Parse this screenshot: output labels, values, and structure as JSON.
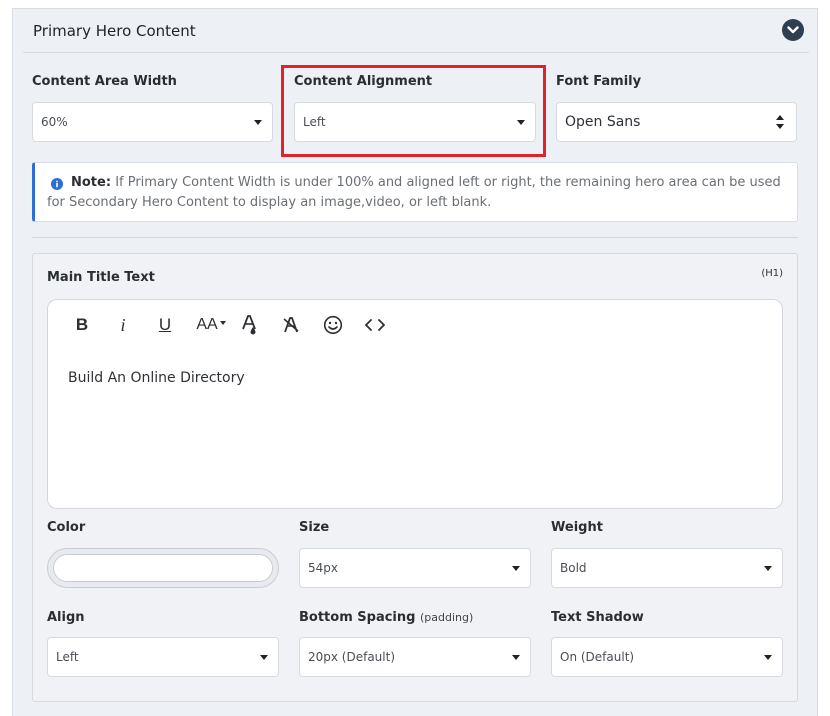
{
  "panel": {
    "title": "Primary Hero Content"
  },
  "fields": {
    "content_area_width": {
      "label": "Content Area Width",
      "value": "60%"
    },
    "content_alignment": {
      "label": "Content Alignment",
      "value": "Left"
    },
    "font_family": {
      "label": "Font Family",
      "value": "Open Sans"
    }
  },
  "note": {
    "label": "Note:",
    "text": "If Primary Content Width is under 100% and aligned left or right, the remaining hero area can be used for Secondary Hero Content to display an image,video, or left blank."
  },
  "title_section": {
    "label": "Main Title Text",
    "tag": "(H1)",
    "toolbar": {
      "bold": "B",
      "italic": "i",
      "underline": "U",
      "font_size": "AA"
    },
    "content": "Build An Online Directory"
  },
  "styles": {
    "color": {
      "label": "Color"
    },
    "size": {
      "label": "Size",
      "value": "54px"
    },
    "weight": {
      "label": "Weight",
      "value": "Bold"
    },
    "align": {
      "label": "Align",
      "value": "Left"
    },
    "bottom_spacing": {
      "label": "Bottom Spacing",
      "sub": "(padding)",
      "value": "20px (Default)"
    },
    "text_shadow": {
      "label": "Text Shadow",
      "value": "On (Default)"
    }
  },
  "colors": {
    "highlight": "#e0222a",
    "note_accent": "#2d6fd6",
    "collapse_button": "#2f3f52"
  },
  "icons": [
    "chevron-down-icon",
    "info-icon",
    "bold-icon",
    "italic-icon",
    "underline-icon",
    "font-size-icon",
    "text-color-icon",
    "clear-format-icon",
    "emoji-icon",
    "code-icon",
    "caret-down-icon",
    "updown-icon"
  ]
}
